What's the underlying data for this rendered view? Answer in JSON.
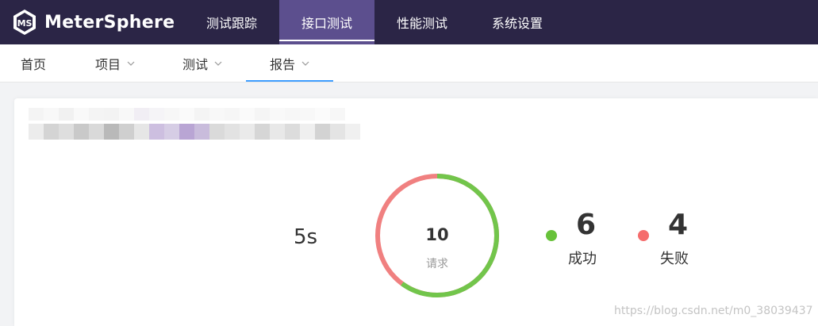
{
  "app": {
    "name": "MeterSphere"
  },
  "top_nav": [
    {
      "label": "测试跟踪",
      "active": false
    },
    {
      "label": "接口测试",
      "active": true
    },
    {
      "label": "性能测试",
      "active": false
    },
    {
      "label": "系统设置",
      "active": false
    }
  ],
  "sub_nav": [
    {
      "label": "首页",
      "has_dropdown": false
    },
    {
      "label": "项目",
      "has_dropdown": true
    },
    {
      "label": "测试",
      "has_dropdown": true
    },
    {
      "label": "报告",
      "has_dropdown": true,
      "active": true
    }
  ],
  "report": {
    "duration": "5s",
    "requests": {
      "count": "10",
      "label": "请求"
    },
    "success": {
      "count": "6",
      "label": "成功",
      "color": "#67c23a"
    },
    "fail": {
      "count": "4",
      "label": "失败",
      "color": "#f56c6c"
    }
  },
  "colors": {
    "topbar": "#2b2546",
    "active_tab": "#5c4f8e",
    "sub_active_underline": "#409eff"
  },
  "watermark": "https://blog.csdn.net/m0_38039437"
}
